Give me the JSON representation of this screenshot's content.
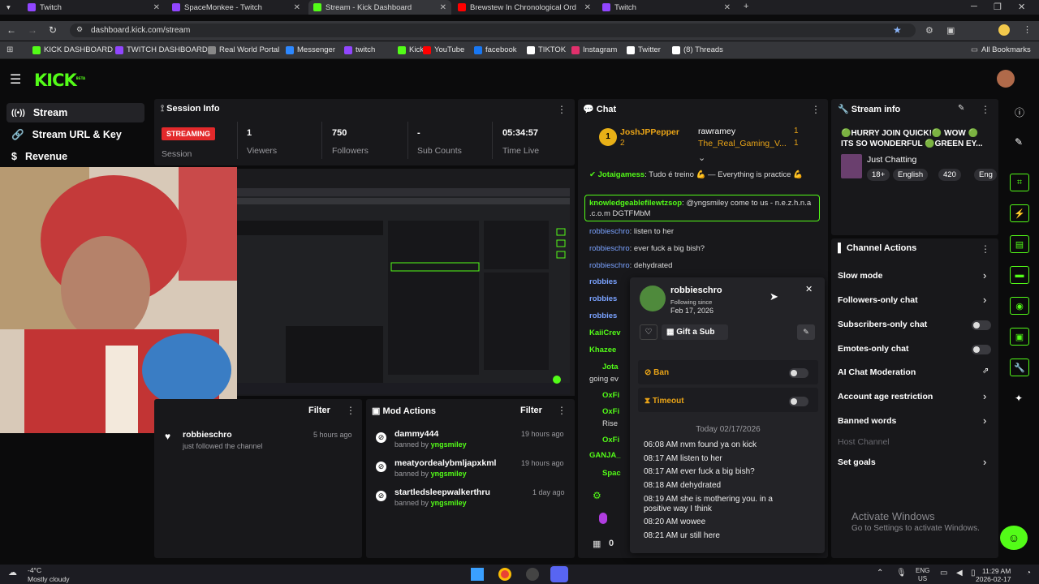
{
  "browser": {
    "tabs": [
      {
        "label": "Twitch",
        "color": "#9146ff"
      },
      {
        "label": "SpaceMonkee - Twitch",
        "color": "#9146ff"
      },
      {
        "label": "Stream - Kick Dashboard",
        "color": "#53fc18"
      },
      {
        "label": "Brewstew In Chronological Ord",
        "color": "#ff0000"
      },
      {
        "label": "Twitch",
        "color": "#9146ff"
      }
    ],
    "url": "dashboard.kick.com/stream",
    "bookmarks": [
      {
        "label": "KICK DASHBOARD",
        "color": "#53fc18"
      },
      {
        "label": "TWITCH DASHBOARD",
        "color": "#9146ff"
      },
      {
        "label": "Real World Portal",
        "color": "#888888"
      },
      {
        "label": "Messenger",
        "color": "#2d88ff"
      },
      {
        "label": "twitch",
        "color": "#9146ff"
      },
      {
        "label": "Kick",
        "color": "#53fc18"
      },
      {
        "label": "YouTube",
        "color": "#ff0000"
      },
      {
        "label": "facebook",
        "color": "#1877f2"
      },
      {
        "label": "TIKTOK",
        "color": "#ffffff"
      },
      {
        "label": "Instagram",
        "color": "#e1306c"
      },
      {
        "label": "Twitter",
        "color": "#ffffff"
      },
      {
        "label": "(8) Threads",
        "color": "#ffffff"
      }
    ],
    "all_bookmarks": "All Bookmarks"
  },
  "kick": {
    "logo": "KICK",
    "logo_badge": "BETA",
    "nav": [
      {
        "label": "Stream",
        "icon": "broadcast-icon"
      },
      {
        "label": "Stream URL & Key",
        "icon": "link-icon"
      },
      {
        "label": "Revenue",
        "icon": "dollar-icon"
      }
    ]
  },
  "session": {
    "title": "Session Info",
    "badge": "STREAMING",
    "badge_sub": "Session",
    "stats": [
      {
        "value": "1",
        "label": "Viewers"
      },
      {
        "value": "750",
        "label": "Followers"
      },
      {
        "value": "-",
        "label": "Sub Counts"
      },
      {
        "value": "05:34:57",
        "label": "Time Live"
      }
    ]
  },
  "activity": {
    "filter": "Filter",
    "items": [
      {
        "user": "robbieschro",
        "text": "just followed the channel",
        "time": "5 hours ago"
      }
    ]
  },
  "mod_actions": {
    "title": "Mod Actions",
    "filter": "Filter",
    "items": [
      {
        "user": "dammy444",
        "by_label": "banned by",
        "by": "yngsmiley",
        "time": "19 hours ago"
      },
      {
        "user": "meatyordealybmljapxkml",
        "by_label": "banned by",
        "by": "yngsmiley",
        "time": "19 hours ago"
      },
      {
        "user": "startledsleepwalkerthru",
        "by_label": "banned by",
        "by": "yngsmiley",
        "time": "1 day ago"
      }
    ]
  },
  "chat": {
    "title": "Chat",
    "top_users": [
      {
        "name": "JoshJPPepper",
        "count": "2"
      },
      {
        "name": "rawramey",
        "count": "1"
      },
      {
        "name": "The_Real_Gaming_V...",
        "count": "1"
      }
    ],
    "messages": [
      {
        "user": "Jotaigamess",
        "text": "Tudo é treino 💪 — Everything is practice 💪"
      },
      {
        "user": "knowledgeablefilewtzsop",
        "text": "@yngsmiley come to us - n.e.z.h.n.a .c.o.m DGTFMbM"
      },
      {
        "user": "robbieschro",
        "text": "listen to her"
      },
      {
        "user": "robbieschro",
        "text": "ever fuck a big bish?"
      },
      {
        "user": "robbieschro",
        "text": "dehydrated"
      }
    ],
    "partial_names": [
      "robbies",
      "robbies",
      "robbies",
      "KaiiCrev",
      "Khazee",
      "Jota",
      "OxFi",
      "OxFi",
      "OxFi",
      "GANJA_",
      "Spac"
    ],
    "partial_texts": [
      "going ev",
      "Rise"
    ],
    "bottom_count": "0"
  },
  "user_popup": {
    "username": "robbieschro",
    "following_label": "Following since",
    "following_date": "Feb 17, 2026",
    "gift_label": "Gift a Sub",
    "ban_label": "Ban",
    "timeout_label": "Timeout",
    "date_header": "Today 02/17/2026",
    "history": [
      "06:08 AM nvm found ya on kick",
      "08:17 AM listen to her",
      "08:17 AM ever fuck a big bish?",
      "08:18 AM dehydrated",
      "08:19 AM she is mothering you. in a",
      "positive way I think",
      "08:20 AM wowee",
      "08:21 AM ur still here"
    ]
  },
  "stream_info": {
    "title": "Stream info",
    "stream_title": "🟢HURRY JOIN QUICK!🟢 WOW 🟢 ITS SO WONDERFUL 🟢GREEN EY...",
    "category": "Just Chatting",
    "tags": [
      "18+",
      "English",
      "420",
      "Eng"
    ]
  },
  "channel_actions": {
    "title": "Channel Actions",
    "items": [
      {
        "label": "Slow mode",
        "control": "chevron"
      },
      {
        "label": "Followers-only chat",
        "control": "chevron"
      },
      {
        "label": "Subscribers-only chat",
        "control": "toggle"
      },
      {
        "label": "Emotes-only chat",
        "control": "toggle"
      },
      {
        "label": "AI Chat Moderation",
        "control": "external"
      },
      {
        "label": "Account age restriction",
        "control": "chevron"
      },
      {
        "label": "Banned words",
        "control": "chevron"
      },
      {
        "label": "Host Channel",
        "control": "disabled"
      },
      {
        "label": "Set goals",
        "control": "chevron"
      }
    ]
  },
  "windows": {
    "activate_title": "Activate Windows",
    "activate_sub": "Go to Settings to activate Windows.",
    "weather_temp": "-4°C",
    "weather_desc": "Mostly cloudy",
    "lang_top": "ENG",
    "lang_bot": "US",
    "time": "11:29 AM",
    "date": "2026-02-17"
  }
}
